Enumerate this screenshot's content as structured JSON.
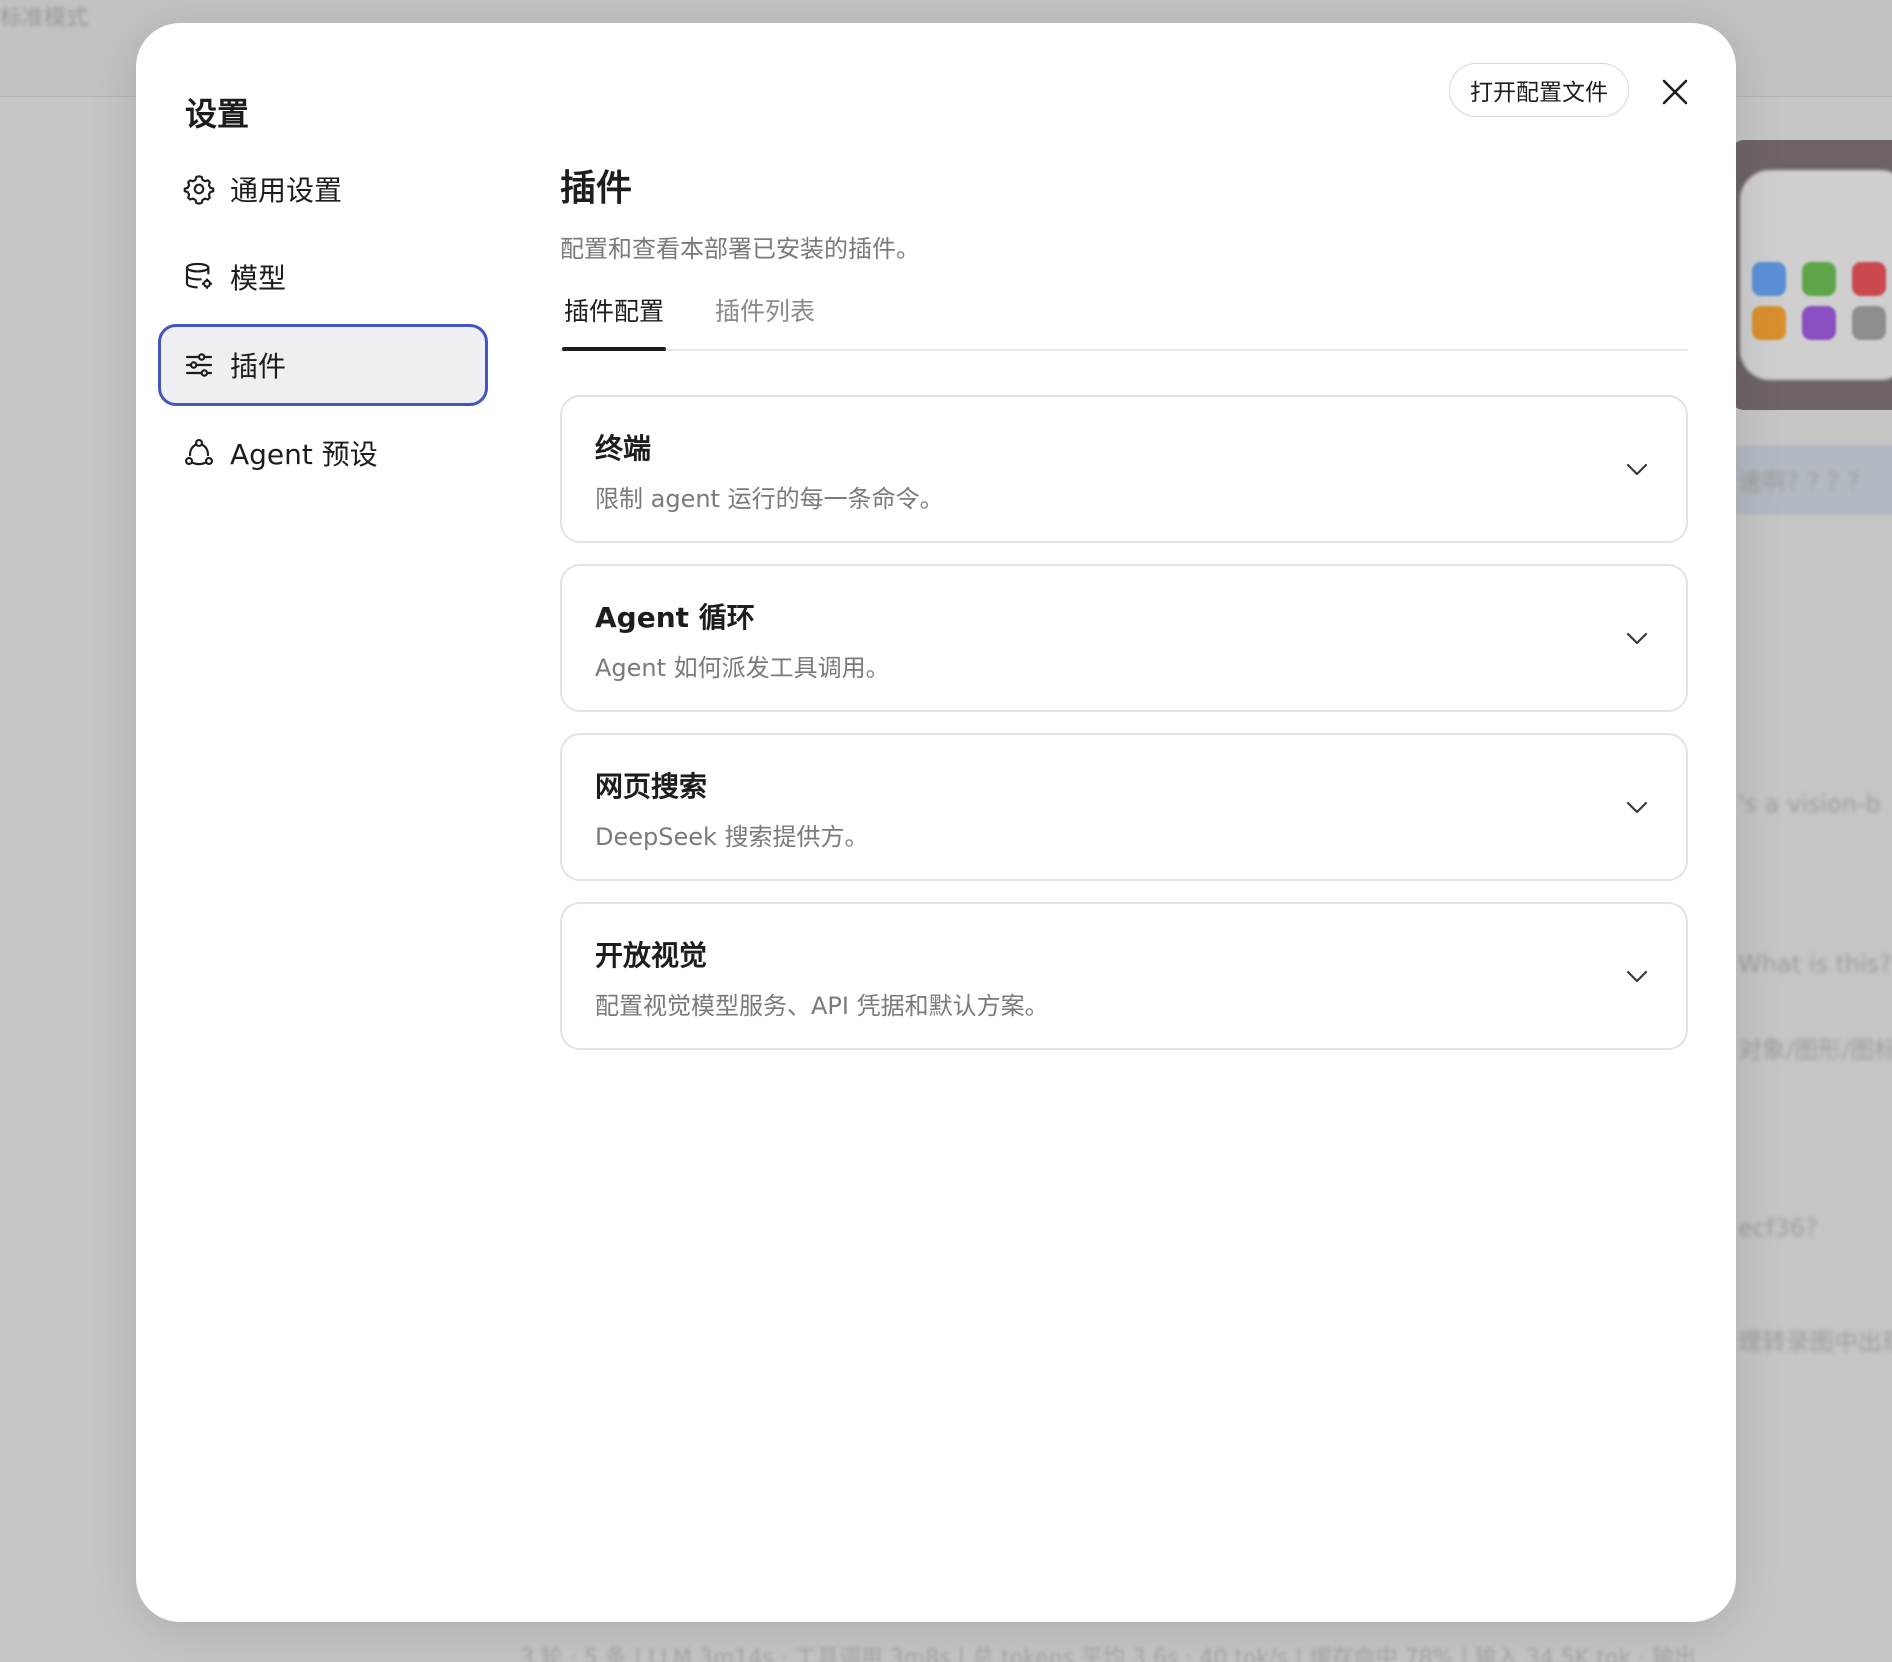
{
  "background": {
    "mode_label": "标准模式",
    "snippets": [
      "速啊? ? ? ?",
      "'s a vision-b",
      "What is this?",
      "对象/图形/图标",
      "ecf36?",
      "理转录图中出现"
    ],
    "status_bar": "3 轮 · 5 条 | LLM 3m14s · 工具调用 3m8s | 总 tokens 平均 3.6s · 40 tok/s | 缓存命中 78% | 输入 34.5K tok · 输出"
  },
  "modal": {
    "title": "设置",
    "open_config_label": "打开配置文件",
    "nav": [
      {
        "label": "通用设置",
        "icon": "gear-icon",
        "active": false
      },
      {
        "label": "模型",
        "icon": "database-icon",
        "active": false
      },
      {
        "label": "插件",
        "icon": "sliders-icon",
        "active": true
      },
      {
        "label": "Agent 预设",
        "icon": "network-icon",
        "active": false
      }
    ],
    "content": {
      "title": "插件",
      "description": "配置和查看本部署已安装的插件。",
      "tabs": [
        {
          "label": "插件配置",
          "active": true
        },
        {
          "label": "插件列表",
          "active": false
        }
      ],
      "cards": [
        {
          "title": "终端",
          "description": "限制 agent 运行的每一条命令。"
        },
        {
          "title": "Agent 循环",
          "description": "Agent 如何派发工具调用。"
        },
        {
          "title": "网页搜索",
          "description": "DeepSeek 搜索提供方。"
        },
        {
          "title": "开放视觉",
          "description": "配置视觉模型服务、API 凭据和默认方案。"
        }
      ]
    }
  },
  "colors": {
    "accent_border": "#4455c0",
    "active_bg": "#eeeef3",
    "text_primary": "#1d1d1f",
    "text_secondary": "#7a7a7e"
  }
}
